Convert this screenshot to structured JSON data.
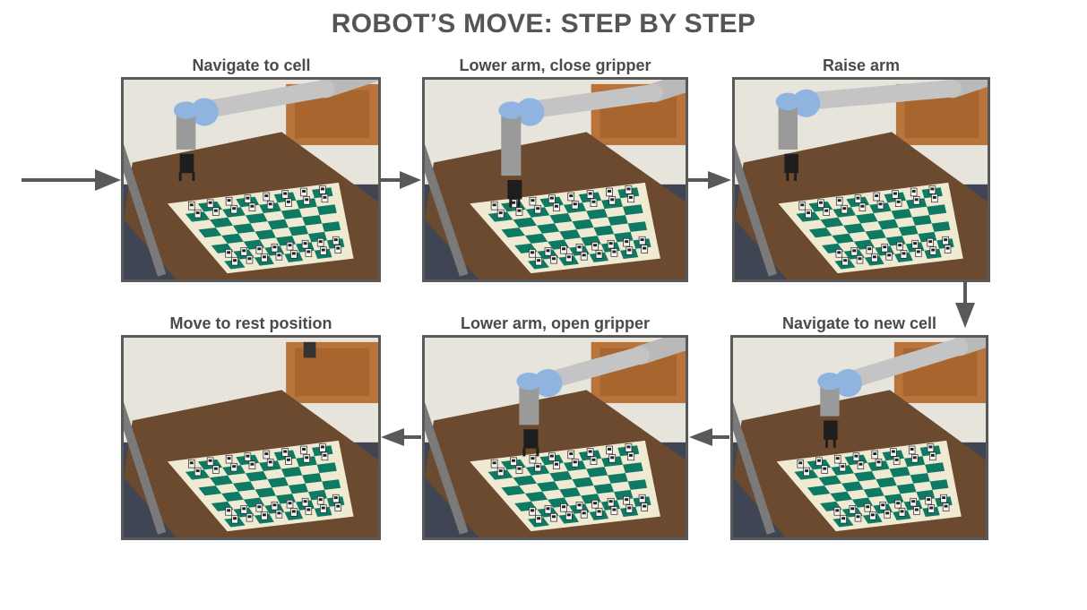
{
  "title": "ROBOT’S MOVE: STEP BY STEP",
  "steps": [
    {
      "label": "Navigate to cell",
      "image": "robot arm above chessboard moving to a cell"
    },
    {
      "label": "Lower arm, close gripper",
      "image": "robot arm lowered gripping a piece"
    },
    {
      "label": "Raise arm",
      "image": "robot arm raised holding a piece"
    },
    {
      "label": "Navigate to new cell",
      "image": "robot arm moving piece over new cell"
    },
    {
      "label": "Lower arm, open gripper",
      "image": "robot arm lowered releasing the piece"
    },
    {
      "label": "Move to rest position",
      "image": "robot arm out of view at rest"
    }
  ],
  "colors": {
    "frame": "#595959",
    "arrow": "#595959",
    "board_dark": "#0f7a63",
    "board_light": "#f1ead2",
    "table": "#6b4a2f"
  }
}
